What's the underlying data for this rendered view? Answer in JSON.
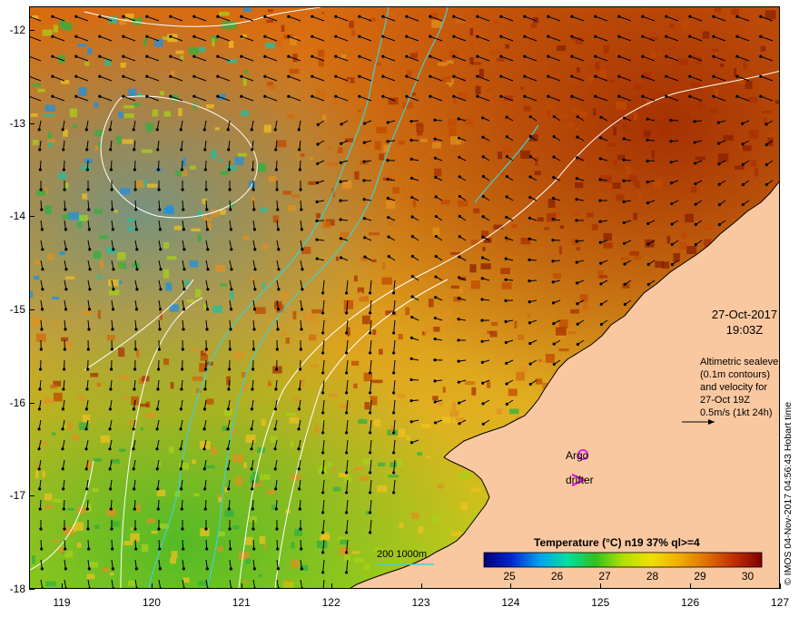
{
  "map": {
    "y_ticks": [
      "-12",
      "-13",
      "-14",
      "-15",
      "-16",
      "-17",
      "-18"
    ],
    "x_ticks": [
      "119",
      "120",
      "121",
      "122",
      "123",
      "124",
      "125",
      "126",
      "127"
    ],
    "date": "27-Oct-2017",
    "time": "19:03Z",
    "altimetry_lines": [
      "Altimetric sealevel",
      "(0.1m contours)",
      "and velocity for",
      "27-Oct 19Z",
      "0.5m/s (1kt 24h)"
    ],
    "legend": {
      "argo": "Argo",
      "drifter": "drifter",
      "isobaths": "200  1000m"
    },
    "colorbar": {
      "title": "Temperature (°C) n19 37% ql>=4",
      "ticks": [
        "25",
        "26",
        "27",
        "28",
        "29",
        "30"
      ]
    },
    "credit": "© IMOS 04-Nov-2017 04:56:43 Hobart time",
    "colors": {
      "land": "#fac8a0",
      "coast": "#000000",
      "contour": "#ffffff",
      "isobath": "#40d0d0",
      "argo": "#e020e0",
      "drifter": "#e020e0"
    },
    "colorbar_stops": [
      "#000078",
      "#0028d0",
      "#00a0f0",
      "#00e0a0",
      "#30c020",
      "#b0e000",
      "#f0e000",
      "#f0b000",
      "#e07000",
      "#c03000",
      "#800000"
    ]
  }
}
